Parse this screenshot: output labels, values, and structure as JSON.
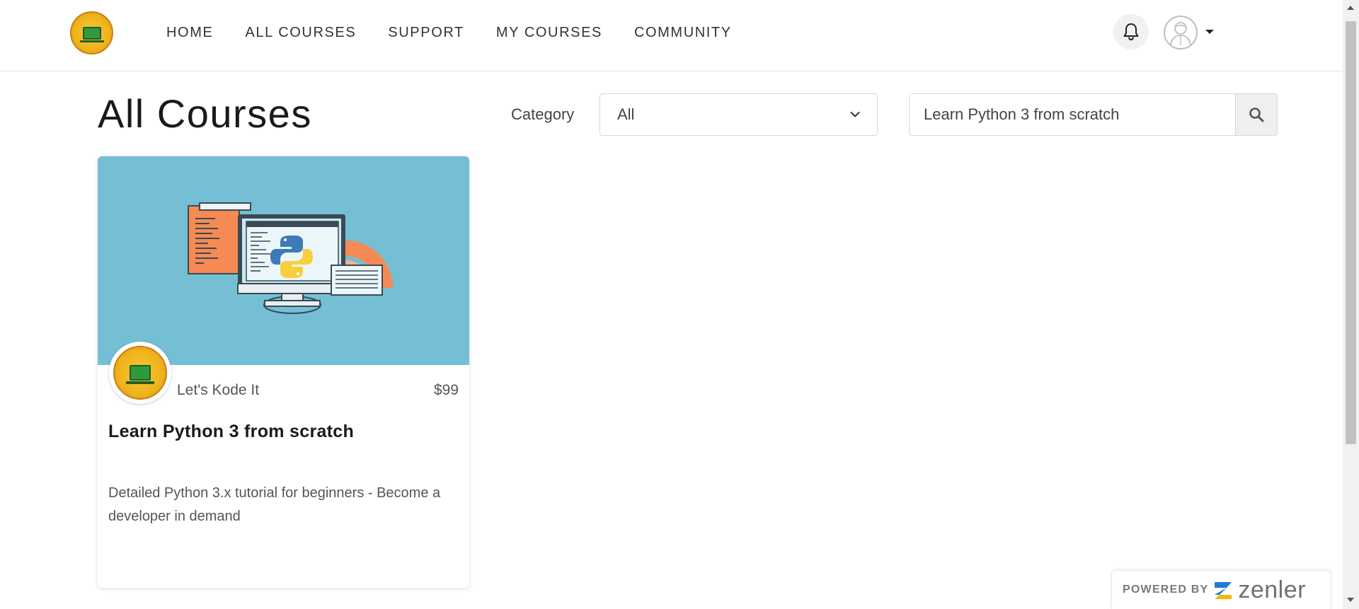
{
  "nav": {
    "items": [
      {
        "label": "HOME"
      },
      {
        "label": "ALL COURSES"
      },
      {
        "label": "SUPPORT"
      },
      {
        "label": "MY COURSES"
      },
      {
        "label": "COMMUNITY"
      }
    ]
  },
  "header": {
    "logo_icon": "lets-kode-it-logo",
    "notification_icon": "bell-icon",
    "avatar_icon": "user-avatar-icon",
    "menu_icon": "caret-down-icon"
  },
  "page": {
    "title": "All Courses",
    "category_label": "Category",
    "category_selected": "All",
    "search_value": "Learn Python 3 from scratch",
    "search_icon": "search-icon"
  },
  "course": {
    "author": "Let's Kode It",
    "price": "$99",
    "title": "Learn Python 3 from scratch",
    "description": "Detailed Python 3.x tutorial for beginners - Become a developer in demand",
    "image_icon": "python-desktop-illustration"
  },
  "footer": {
    "powered_by": "POWERED BY",
    "brand": "zenler"
  },
  "colors": {
    "card_image_bg": "#74bfd3",
    "logo_gold": "#efb21b",
    "laptop_green": "#2f9a3d",
    "brand_blue": "#1e7bd6",
    "brand_yellow": "#f5b700"
  }
}
